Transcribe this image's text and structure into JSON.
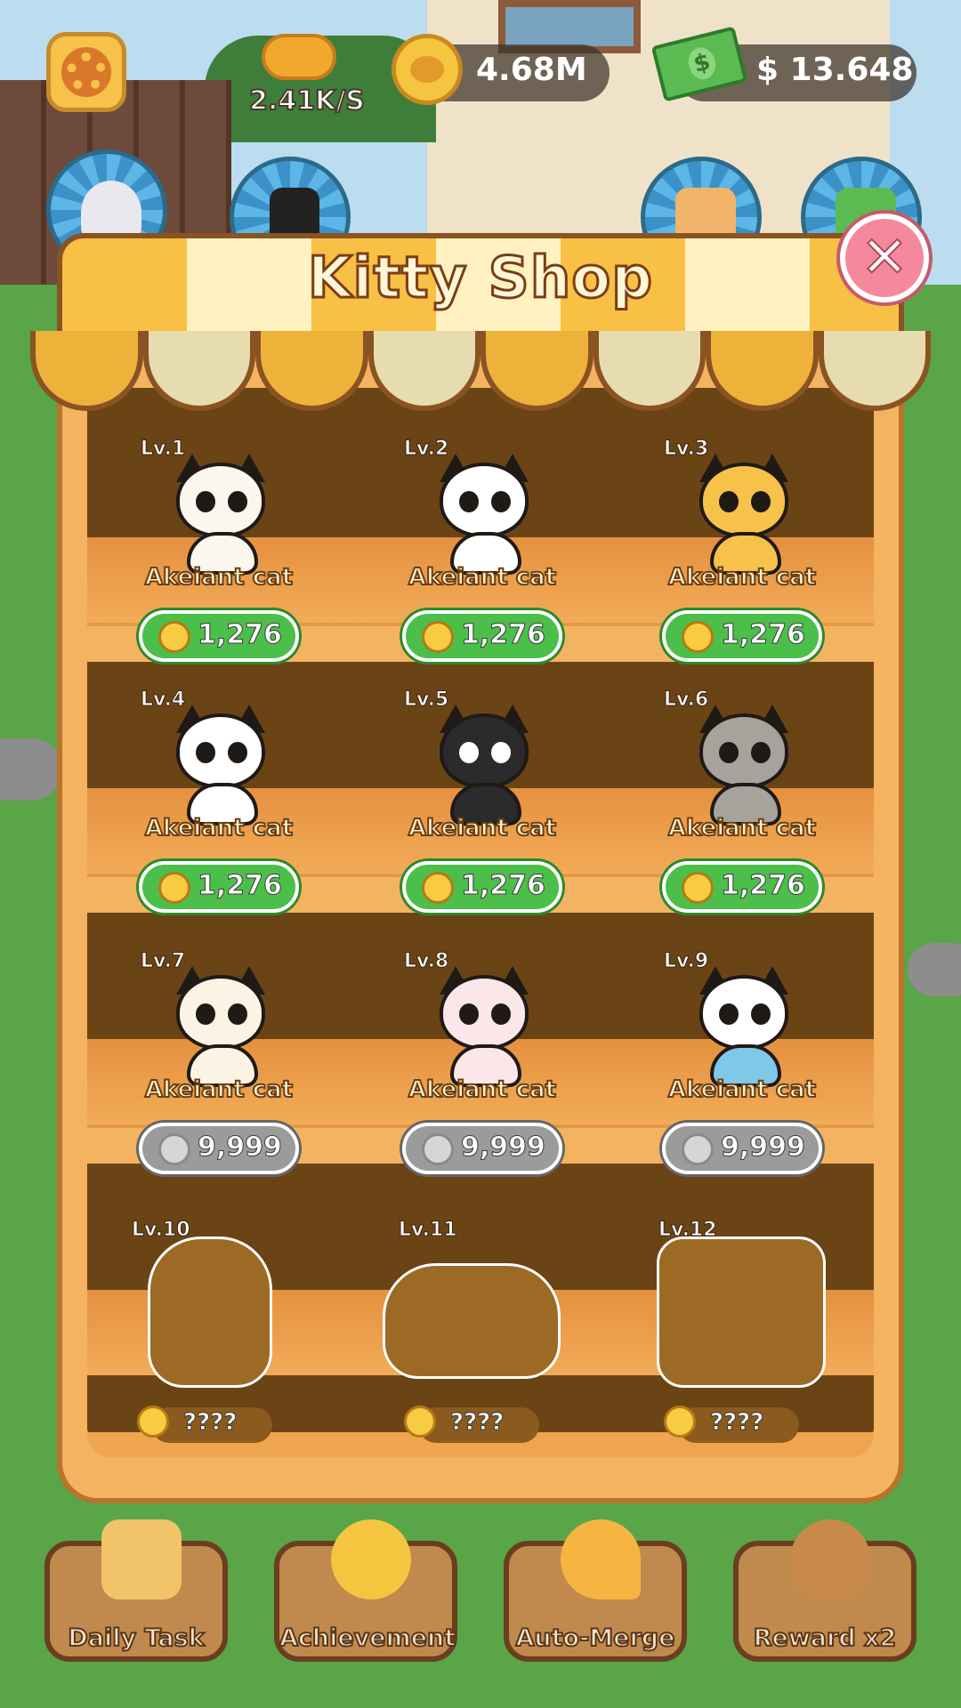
{
  "hud": {
    "income_rate": "2.41K/S",
    "coins": "4.68M",
    "cash": "$ 13.648"
  },
  "shop": {
    "title": "Kitty Shop",
    "items": [
      {
        "level": "Lv.1",
        "name": "Akeiant cat",
        "price": "1,276",
        "currency": "gold-cat-coin",
        "state": "available",
        "color": "#fbf6ee"
      },
      {
        "level": "Lv.2",
        "name": "Akeiant cat",
        "price": "1,276",
        "currency": "gold-cat-coin",
        "state": "available",
        "color": "#ffffff"
      },
      {
        "level": "Lv.3",
        "name": "Akeiant cat",
        "price": "1,276",
        "currency": "gold-cat-coin",
        "state": "available",
        "color": "#f7c24a"
      },
      {
        "level": "Lv.4",
        "name": "Akeiant cat",
        "price": "1,276",
        "currency": "gold-cat-coin",
        "state": "available",
        "color": "#ffffff"
      },
      {
        "level": "Lv.5",
        "name": "Akeiant cat",
        "price": "1,276",
        "currency": "gold-cat-coin",
        "state": "available",
        "color": "#2b2b2b"
      },
      {
        "level": "Lv.6",
        "name": "Akeiant cat",
        "price": "1,276",
        "currency": "gold-cat-coin",
        "state": "available",
        "color": "#a7a29b"
      },
      {
        "level": "Lv.7",
        "name": "Akeiant cat",
        "price": "9,999",
        "currency": "silver-cat-coin",
        "state": "locked",
        "color": "#fbf3e3"
      },
      {
        "level": "Lv.8",
        "name": "Akeiant cat",
        "price": "9,999",
        "currency": "silver-cat-coin",
        "state": "locked",
        "color": "#fbe6ea"
      },
      {
        "level": "Lv.9",
        "name": "Akeiant cat",
        "price": "9,999",
        "currency": "silver-cat-coin",
        "state": "locked",
        "color": "#ffffff"
      },
      {
        "level": "Lv.10",
        "price": "????",
        "currency": "gold-cat-coin",
        "state": "unknown"
      },
      {
        "level": "Lv.11",
        "price": "????",
        "currency": "gold-cat-coin",
        "state": "unknown"
      },
      {
        "level": "Lv.12",
        "price": "????",
        "currency": "gold-cat-coin",
        "state": "unknown"
      }
    ]
  },
  "bottom_bar": {
    "daily_task": "Daily Task",
    "achievement": "Achievement",
    "auto_merge": "Auto-Merge",
    "reward": "Reward x2"
  },
  "colors": {
    "accent": "#f8c044",
    "buy_green": "#4bbf4a",
    "locked_gray": "#9b9b9b",
    "close_pink": "#f4899b",
    "shelf_wood": "#6b4416"
  }
}
